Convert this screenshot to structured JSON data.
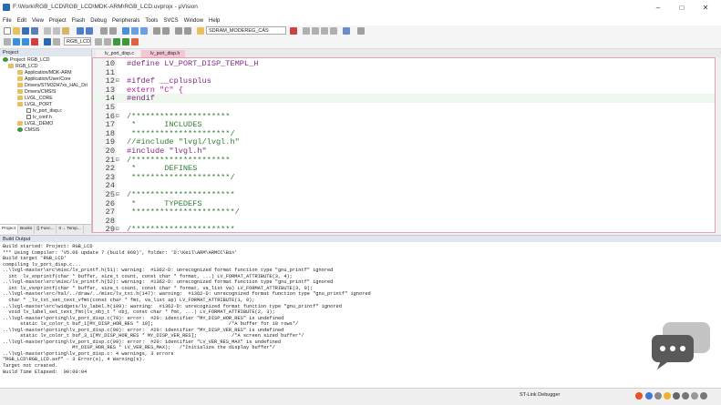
{
  "window": {
    "title": "F:\\Work\\RGB_LCD\\RGB_LCD\\MDK-ARM\\RGB_LCD.uvprojx - µVision",
    "minimize": "–",
    "maximize": "□",
    "close": "✕"
  },
  "menu": [
    "File",
    "Edit",
    "View",
    "Project",
    "Flash",
    "Debug",
    "Peripherals",
    "Tools",
    "SVCS",
    "Window",
    "Help"
  ],
  "toolbar": {
    "function_select": "SDRAM_MODEREG_CAS",
    "target_select": "RGB_LCD"
  },
  "project_panel": {
    "header": "Project",
    "tree": [
      {
        "label": "Project: RGB_LCD",
        "level": 0,
        "icon": "project-icon"
      },
      {
        "label": "RGB_LCD",
        "level": 1,
        "icon": "folder-icon"
      },
      {
        "label": "Application/MDK-ARM",
        "level": 2,
        "icon": "folder-icon"
      },
      {
        "label": "Application/User/Core",
        "level": 2,
        "icon": "folder-icon"
      },
      {
        "label": "Drivers/STM32H7xx_HAL_Dri",
        "level": 2,
        "icon": "folder-icon"
      },
      {
        "label": "Drivers/CMSIS",
        "level": 2,
        "icon": "folder-icon"
      },
      {
        "label": "LVGL_CORE",
        "level": 2,
        "icon": "folder-icon"
      },
      {
        "label": "LVGL_PORT",
        "level": 2,
        "icon": "folder-icon"
      },
      {
        "label": "lv_port_disp.c",
        "level": 3,
        "icon": "file-icon"
      },
      {
        "label": "lv_conf.h",
        "level": 3,
        "icon": "file-icon"
      },
      {
        "label": "LVGL_DEMO",
        "level": 2,
        "icon": "folder-icon"
      },
      {
        "label": "CMSIS",
        "level": 2,
        "icon": "gear-icon"
      }
    ],
    "tabs": [
      "Project",
      "Books",
      "{} Func...",
      "0→ Temp..."
    ]
  },
  "editor": {
    "tabs": [
      {
        "label": "lv_port_disp.c",
        "active": false
      },
      {
        "label": "lv_port_disp.h",
        "active": true
      }
    ],
    "lines": [
      {
        "n": "10",
        "fold": "",
        "cls": "pp",
        "text": "#define LV_PORT_DISP_TEMPL_H"
      },
      {
        "n": "11",
        "fold": "",
        "cls": "",
        "text": ""
      },
      {
        "n": "12",
        "fold": "⊟",
        "cls": "pp",
        "text": "#ifdef __cplusplus"
      },
      {
        "n": "13",
        "fold": "",
        "cls": "st",
        "text": "extern \"C\" {"
      },
      {
        "n": "14",
        "fold": "",
        "cls": "pp",
        "text": "#endif"
      },
      {
        "n": "15",
        "fold": "",
        "cls": "",
        "text": ""
      },
      {
        "n": "16",
        "fold": "⊟",
        "cls": "cm",
        "text": "/*********************"
      },
      {
        "n": "17",
        "fold": "",
        "cls": "cm",
        "text": " *      INCLUDES"
      },
      {
        "n": "18",
        "fold": "",
        "cls": "cm",
        "text": " *********************/"
      },
      {
        "n": "19",
        "fold": "",
        "cls": "cm",
        "text": "//#include \"lvgl/lvgl.h\""
      },
      {
        "n": "20",
        "fold": "",
        "cls": "pp",
        "text": "#include \"lvgl.h\""
      },
      {
        "n": "21",
        "fold": "⊟",
        "cls": "cm",
        "text": "/*********************"
      },
      {
        "n": "22",
        "fold": "",
        "cls": "cm",
        "text": " *      DEFINES"
      },
      {
        "n": "23",
        "fold": "",
        "cls": "cm",
        "text": " *********************/"
      },
      {
        "n": "24",
        "fold": "",
        "cls": "",
        "text": ""
      },
      {
        "n": "25",
        "fold": "⊟",
        "cls": "cm",
        "text": "/**********************"
      },
      {
        "n": "26",
        "fold": "",
        "cls": "cm",
        "text": " *      TYPEDEFS"
      },
      {
        "n": "27",
        "fold": "",
        "cls": "cm",
        "text": " **********************/"
      },
      {
        "n": "28",
        "fold": "",
        "cls": "",
        "text": ""
      },
      {
        "n": "29",
        "fold": "⊟",
        "cls": "cm",
        "text": "/**********************"
      }
    ]
  },
  "build_output": {
    "header": "Build Output",
    "lines": [
      "Build started: Project: RGB_LCD",
      "*** Using Compiler: 'V5.06 update 7 (build 960)', folder: 'D:\\Keil\\ARM\\ARMCC\\Bin'",
      "Build target 'RGB_LCD'",
      "compiling lv_port_disp.c...",
      "..\\lvgl-master\\src\\misc/lv_printf.h(51): warning:  #1362-D: unrecognized format function type \"gnu_printf\" ignored",
      "  int  lv_snprintf(char * buffer, size_t count, const char * format, ...) LV_FORMAT_ATTRIBUTE(3, 4);",
      "..\\lvgl-master\\src\\misc/lv_printf.h(52): warning:  #1362-D: unrecognized format function type \"gnu_printf\" ignored",
      "  int lv_vsnprintf(char * buffer, size_t count, const char * format, va_list va) LV_FORMAT_ATTRIBUTE(3, 0);",
      "..\\lvgl-master\\src/hal/../draw/../misc/lv_txt.h(147): warning:  #1362-D: unrecognized format function type \"gnu_printf\" ignored",
      "  char * _lv_txt_set_text_vfmt(const char * fmt, va_list ap) LV_FORMAT_ATTRIBUTE(1, 0);",
      "..\\lvgl-master\\src\\widgets/lv_label.h(109): warning:  #1362-D: unrecognized format function type \"gnu_printf\" ignored",
      "  void lv_label_set_text_fmt(lv_obj_t * obj, const char * fmt, ...) LV_FORMAT_ATTRIBUTE(2, 3);",
      "..\\lvgl-master\\porting\\lv_port_disp.c(78): error:  #20: identifier \"MY_DISP_HOR_RES\" is undefined",
      "      static lv_color_t buf_1[MY_DISP_HOR_RES * 10];                          /*A buffer for 10 rows*/",
      "..\\lvgl-master\\porting\\lv_port_disp.c(90): error:  #20: identifier \"MY_DISP_VER_RES\" is undefined",
      "      static lv_color_t buf_3_1[MY_DISP_HOR_RES * MY_DISP_VER_RES];            /*A screen sized buffer*/",
      "..\\lvgl-master\\porting\\lv_port_disp.c(99): error:  #20: identifier \"LV_VER_RES_MAX\" is undefined",
      "                        MY_DISP_HOR_RES * LV_VER_RES_MAX);   /*Initialize the display buffer*/",
      "..\\lvgl-master\\porting\\lv_port_disp.c: 4 warnings, 3 errors",
      "\"RGB_LCD\\RGB_LCD.axf\" - 3 Error(s), 4 Warning(s).",
      "Target not created.",
      "Build Time Elapsed:  00:00:04"
    ]
  },
  "status_bar": {
    "debugger": "ST-Link Debugger"
  },
  "tray_icons": [
    "sogou-ime-icon",
    "chinese-input-icon",
    "punctuation-icon",
    "emoji-icon",
    "microphone-icon",
    "keyboard-icon",
    "skin-icon",
    "menu-grid-icon"
  ]
}
